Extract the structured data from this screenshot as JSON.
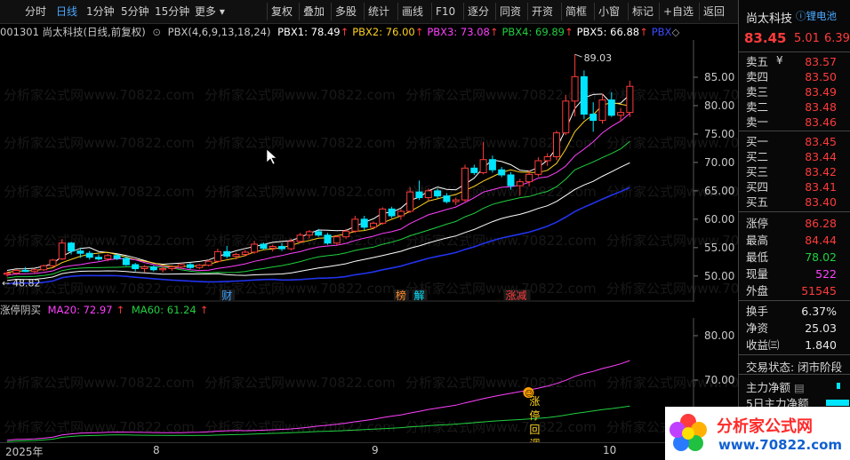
{
  "toolbar": {
    "periods": [
      "分时",
      "日线",
      "1分钟",
      "5分钟",
      "15分钟",
      "更多"
    ],
    "more_caret": "▾",
    "buttons": [
      "复权",
      "叠加",
      "多股",
      "统计",
      "画线",
      "F10",
      "逐分",
      "同资",
      "开资",
      "简框",
      "小窗",
      "标记",
      "+自选",
      "返回"
    ]
  },
  "info": {
    "code_name": "001301 尚太科技(日线,前复权)",
    "indicator": "PBX(4,6,9,13,18,24)",
    "pbx": [
      {
        "label": "PBX1: 78.49",
        "color": "#ffffff"
      },
      {
        "label": "PBX2: 76.00",
        "color": "#ffd21f"
      },
      {
        "label": "PBX3: 73.08",
        "color": "#ff40ff"
      },
      {
        "label": "PBX4: 69.89",
        "color": "#20d040"
      },
      {
        "label": "PBX5: 66.88",
        "color": "#ffffff"
      },
      {
        "label": "PBX",
        "color": "#3a4bff"
      }
    ],
    "arrow": "↑",
    "diamond": "◇"
  },
  "main_axis": {
    "ticks": [
      "85.00",
      "80.00",
      "75.00",
      "70.00",
      "65.00",
      "60.00",
      "55.00",
      "50.00"
    ]
  },
  "annotations": {
    "high": "89.03",
    "low": "48.82",
    "markers": [
      "财",
      "榜",
      "解",
      "涨减"
    ]
  },
  "sub_info": {
    "name": "涨停阴买",
    "ma20": "MA20: 72.97",
    "ma60": "MA60: 61.24",
    "arrow": "↑"
  },
  "sub_axis": {
    "ticks": [
      "80.00",
      "70.00",
      "60.00"
    ]
  },
  "signal_text": "涨停回调",
  "x_axis": [
    "2025年",
    "8",
    "9",
    "10"
  ],
  "quote": {
    "name": "尚太科技",
    "sector": "锂电池",
    "price": "83.45",
    "change": "5.01",
    "pct": "6.39",
    "ask": [
      [
        "卖五",
        "83.57"
      ],
      [
        "卖四",
        "83.50"
      ],
      [
        "卖三",
        "83.49"
      ],
      [
        "卖二",
        "83.48"
      ],
      [
        "卖一",
        "83.46"
      ]
    ],
    "bid": [
      [
        "买一",
        "83.45"
      ],
      [
        "买二",
        "83.44"
      ],
      [
        "买三",
        "83.42"
      ],
      [
        "买四",
        "83.41"
      ],
      [
        "买五",
        "83.40"
      ]
    ],
    "ask_unit": "¥",
    "stats": [
      [
        "涨停",
        "86.28"
      ],
      [
        "最高",
        "84.44"
      ],
      [
        "最低",
        "78.02"
      ],
      [
        "现量",
        "522"
      ],
      [
        "外盘",
        "51545"
      ]
    ],
    "stats2": [
      [
        "换手",
        "6.37%"
      ],
      [
        "净资",
        "25.03"
      ],
      [
        "收益㈢",
        "1.840"
      ]
    ],
    "status": "交易状态: 闭市阶段",
    "flows": [
      "主力净额",
      "5日主力净额"
    ]
  },
  "logo": {
    "title": "分析家公式网",
    "url": "www.70822.com"
  },
  "watermark": "分析家公式网www.70822.com",
  "colors": {
    "up": "#ff3b3b",
    "down": "#00e5ff",
    "ma1": "#ffffff",
    "ma2": "#ffd21f",
    "ma3": "#ff40ff",
    "ma4": "#20d040",
    "ma5": "#ffffff",
    "ma6": "#2233ee"
  },
  "chart_data": {
    "type": "candlestick",
    "ylim": [
      47,
      90
    ],
    "candles": [
      [
        50.3,
        50.8,
        49.9,
        50.5
      ],
      [
        50.5,
        51.2,
        50.2,
        51.0
      ],
      [
        51.0,
        51.6,
        50.7,
        50.8
      ],
      [
        50.8,
        51.3,
        50.4,
        51.1
      ],
      [
        51.1,
        52.0,
        50.9,
        51.8
      ],
      [
        51.8,
        53.0,
        51.5,
        52.8
      ],
      [
        53.0,
        56.5,
        52.8,
        55.8
      ],
      [
        55.8,
        56.0,
        53.8,
        54.4
      ],
      [
        54.4,
        55.0,
        53.2,
        54.0
      ],
      [
        54.0,
        54.4,
        52.9,
        53.3
      ],
      [
        53.3,
        53.8,
        52.7,
        53.0
      ],
      [
        53.0,
        53.9,
        52.6,
        53.6
      ],
      [
        53.6,
        53.9,
        52.8,
        53.1
      ],
      [
        53.1,
        53.5,
        51.8,
        52.0
      ],
      [
        52.0,
        52.3,
        50.8,
        51.3
      ],
      [
        51.3,
        51.9,
        50.6,
        51.6
      ],
      [
        51.6,
        51.9,
        50.8,
        51.1
      ],
      [
        51.1,
        51.7,
        50.6,
        51.3
      ],
      [
        51.3,
        51.9,
        50.9,
        51.6
      ],
      [
        51.6,
        52.3,
        51.3,
        52.0
      ],
      [
        52.0,
        52.4,
        51.2,
        51.5
      ],
      [
        51.5,
        52.1,
        51.2,
        51.9
      ],
      [
        51.9,
        52.9,
        51.7,
        52.6
      ],
      [
        52.6,
        54.8,
        52.3,
        54.3
      ],
      [
        54.3,
        55.3,
        53.1,
        53.5
      ],
      [
        53.5,
        54.1,
        52.9,
        53.8
      ],
      [
        53.8,
        54.6,
        53.4,
        54.2
      ],
      [
        54.2,
        56.2,
        53.9,
        55.6
      ],
      [
        55.6,
        55.9,
        54.6,
        54.9
      ],
      [
        54.9,
        55.5,
        54.3,
        55.2
      ],
      [
        55.2,
        55.8,
        54.4,
        54.8
      ],
      [
        54.8,
        56.6,
        54.5,
        56.1
      ],
      [
        56.1,
        57.6,
        55.8,
        57.2
      ],
      [
        57.2,
        58.1,
        56.6,
        57.8
      ],
      [
        57.8,
        58.3,
        56.9,
        57.2
      ],
      [
        57.2,
        57.6,
        55.5,
        55.8
      ],
      [
        55.8,
        57.2,
        55.4,
        56.9
      ],
      [
        56.9,
        58.3,
        56.5,
        57.9
      ],
      [
        57.9,
        60.6,
        57.6,
        60.0
      ],
      [
        60.0,
        60.6,
        58.1,
        58.6
      ],
      [
        58.6,
        59.6,
        58.2,
        59.3
      ],
      [
        59.3,
        62.1,
        59.0,
        61.8
      ],
      [
        61.8,
        62.2,
        60.2,
        60.6
      ],
      [
        60.6,
        61.8,
        59.9,
        61.4
      ],
      [
        61.4,
        65.6,
        61.1,
        64.8
      ],
      [
        64.8,
        66.8,
        63.4,
        63.8
      ],
      [
        63.8,
        65.4,
        63.2,
        65.0
      ],
      [
        65.0,
        65.4,
        63.7,
        64.1
      ],
      [
        64.1,
        64.6,
        62.8,
        63.1
      ],
      [
        63.1,
        63.8,
        62.5,
        63.4
      ],
      [
        63.4,
        69.6,
        63.1,
        69.0
      ],
      [
        69.0,
        69.6,
        67.8,
        68.2
      ],
      [
        68.2,
        73.6,
        67.9,
        70.5
      ],
      [
        70.5,
        71.2,
        68.2,
        68.7
      ],
      [
        68.7,
        69.2,
        67.4,
        67.8
      ],
      [
        67.8,
        68.3,
        65.2,
        65.9
      ],
      [
        65.9,
        67.1,
        64.2,
        66.6
      ],
      [
        66.6,
        68.6,
        65.8,
        67.9
      ],
      [
        67.9,
        70.9,
        67.5,
        70.3
      ],
      [
        70.3,
        71.6,
        69.4,
        71.0
      ],
      [
        71.0,
        75.6,
        70.4,
        75.2
      ],
      [
        75.2,
        81.9,
        74.8,
        80.8
      ],
      [
        80.8,
        89.0,
        78.1,
        85.1
      ],
      [
        85.1,
        86.2,
        77.6,
        78.5
      ],
      [
        78.5,
        80.6,
        75.4,
        77.4
      ],
      [
        77.4,
        82.1,
        76.8,
        81.0
      ],
      [
        81.0,
        82.4,
        78.0,
        78.3
      ],
      [
        78.3,
        79.6,
        77.3,
        78.8
      ],
      [
        78.8,
        84.4,
        78.0,
        83.4
      ]
    ],
    "markers": [
      {
        "idx": 24,
        "text": "财",
        "color": "#3aa0ff"
      },
      {
        "idx": 43,
        "text": "榜",
        "color": "#ff8a2a"
      },
      {
        "idx": 45,
        "text": "解",
        "color": "#00e5ff"
      },
      {
        "idx": 55,
        "text": "涨减",
        "color": "#ff3b3b"
      }
    ],
    "sub_ylim": [
      56,
      84
    ],
    "signal_idx": 48
  }
}
